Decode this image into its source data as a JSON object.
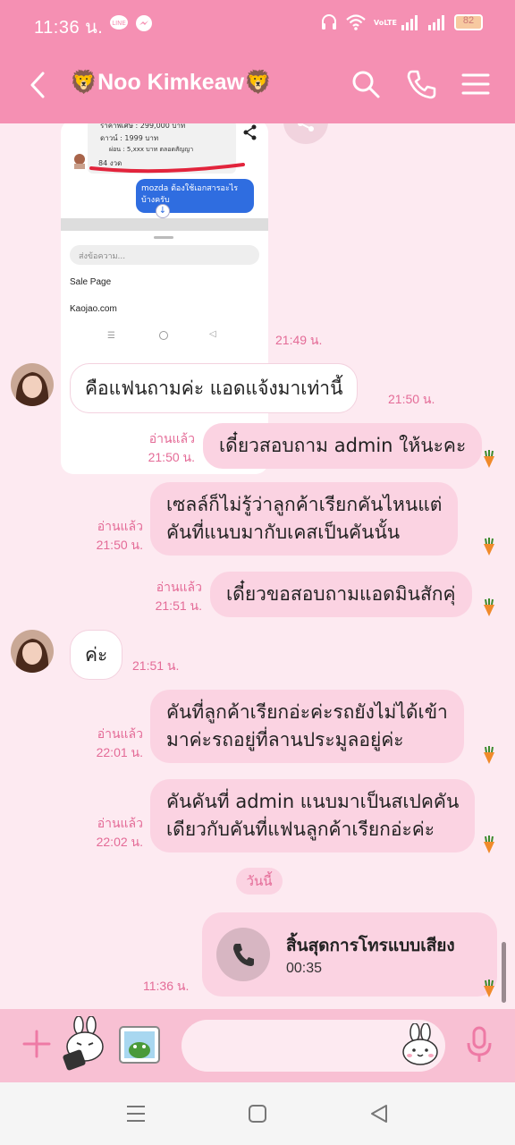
{
  "status_bar": {
    "time": "11:36 น.",
    "network": "VoLTE",
    "battery": "82"
  },
  "header": {
    "title": "🦁Noo  Kimkeaw🦁"
  },
  "shared_image": {
    "price_line": "ราคาพิเศษ : 299,000 บาท",
    "down_line": "ดาวน์ : 1999 บาท",
    "installment_line": "ผ่อน : 5,xxx บาท ตลอดสัญญา",
    "term_line": "84 งวด",
    "blue_bubble": "mozda ต้องใช้เอกสารอะไรบ้างครับ",
    "input_placeholder": "ส่งข้อความ...",
    "menu_1": "Sale Page",
    "menu_2": "Kaojao.com",
    "time": "21:49 น."
  },
  "messages": [
    {
      "text": "คือแฟนถามค่ะ  แอดแจ้งมาเท่านี้",
      "time": "21:50 น."
    },
    {
      "read": "อ่านแล้ว",
      "time": "21:50 น.",
      "text": "เดี๋ยวสอบถาม admin ให้นะคะ"
    },
    {
      "read": "อ่านแล้ว",
      "time": "21:50 น.",
      "line1": "เซลล์ก็ไม่รู้ว่าลูกค้าเรียกคันไหนแต่",
      "line2": "คันที่แนบมากับเคสเป็นคันนั้น"
    },
    {
      "read": "อ่านแล้ว",
      "time": "21:51 น.",
      "text": "เดี๋ยวขอสอบถามแอดมินสักคุ่"
    },
    {
      "text": "ค่ะ",
      "time": "21:51 น."
    },
    {
      "read": "อ่านแล้ว",
      "time": "22:01 น.",
      "line1": "คันที่ลูกค้าเรียกอ่ะค่ะรถยังไม่ได้เข้า",
      "line2": "มาค่ะรถอยู่ที่ลานประมูลอยู่ค่ะ"
    },
    {
      "read": "อ่านแล้ว",
      "time": "22:02 น.",
      "line1": "คันคันที่ admin แนบมาเป็นสเปคคัน",
      "line2": "เดียวกับคันที่แฟนลูกค้าเรียกอ่ะค่ะ"
    }
  ],
  "date_divider": "วันนี้",
  "call": {
    "title": "สิ้นสุดการโทรแบบเสียง",
    "duration": "00:35",
    "time": "11:36 น."
  },
  "colors": {
    "header_pink": "#f590b3",
    "bubble_out": "#fbd3e2",
    "background": "#fdeaf1",
    "accent_text": "#e46b97"
  }
}
